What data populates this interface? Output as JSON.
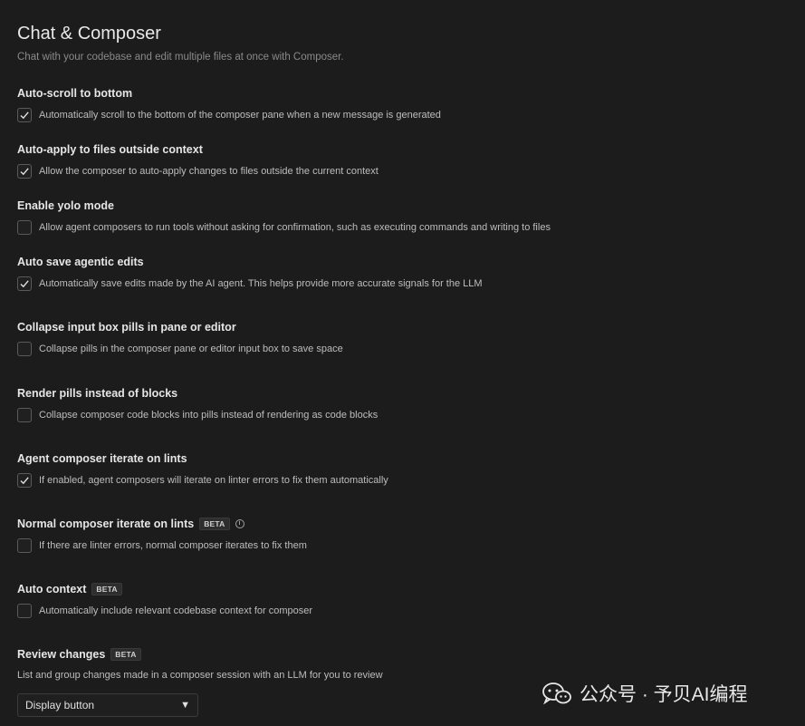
{
  "page": {
    "title": "Chat & Composer",
    "subtitle": "Chat with your codebase and edit multiple files at once with Composer."
  },
  "settings": [
    {
      "title": "Auto-scroll to bottom",
      "description": "Automatically scroll to the bottom of the composer pane when a new message is generated",
      "checked": true
    },
    {
      "title": "Auto-apply to files outside context",
      "description": "Allow the composer to auto-apply changes to files outside the current context",
      "checked": true
    },
    {
      "title": "Enable yolo mode",
      "description": "Allow agent composers to run tools without asking for confirmation, such as executing commands and writing to files",
      "checked": false
    },
    {
      "title": "Auto save agentic edits",
      "description": "Automatically save edits made by the AI agent. This helps provide more accurate signals for the LLM",
      "checked": true
    },
    {
      "title": "Collapse input box pills in pane or editor",
      "description": "Collapse pills in the composer pane or editor input box to save space",
      "checked": false
    },
    {
      "title": "Render pills instead of blocks",
      "description": "Collapse composer code blocks into pills instead of rendering as code blocks",
      "checked": false
    },
    {
      "title": "Agent composer iterate on lints",
      "description": "If enabled, agent composers will iterate on linter errors to fix them automatically",
      "checked": true
    },
    {
      "title": "Normal composer iterate on lints",
      "badge": "BETA",
      "info_icon": "info-icon",
      "description": "If there are linter errors, normal composer iterates to fix them",
      "checked": false
    },
    {
      "title": "Auto context",
      "badge": "BETA",
      "description": "Automatically include relevant codebase context for composer",
      "checked": false
    }
  ],
  "review_changes": {
    "title": "Review changes",
    "badge": "BETA",
    "description": "List and group changes made in a composer session with an LLM for you to review",
    "selected": "Display button"
  },
  "watermark": {
    "icon": "wechat-icon",
    "text": "公众号 · 予贝AI编程"
  },
  "colors": {
    "background": "#1c1c1c",
    "title": "#e8e8e8",
    "muted": "#8a8a8a"
  }
}
